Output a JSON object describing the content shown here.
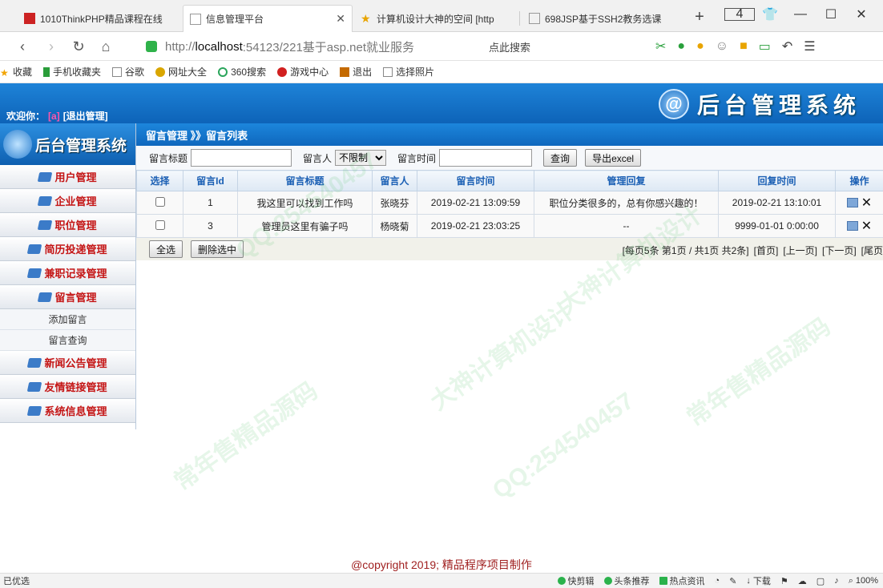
{
  "browser": {
    "tabs": [
      {
        "title": "1010ThinkPHP精品课程在线",
        "favicon_color": "#cc2222"
      },
      {
        "title": "信息管理平台",
        "favicon_color": "#999999",
        "active": true
      },
      {
        "title": "计算机设计大神的空间 [http",
        "favicon_color": "#e8a400"
      },
      {
        "title": "698JSP基于SSH2教务选课",
        "favicon_color": "#999999"
      }
    ],
    "tab_count": "4",
    "address": {
      "prefix": "http://",
      "host": "localhost",
      "rest": ":54123/221基于asp.net就业服务"
    },
    "search_placeholder": "点此搜索",
    "bookmarks": [
      {
        "label": "收藏",
        "icon": "star-icon",
        "color": "#f2a400"
      },
      {
        "label": "手机收藏夹",
        "icon": "phone-icon",
        "color": "#2a9d3a"
      },
      {
        "label": "谷歌",
        "icon": "page-icon",
        "color": "#888888"
      },
      {
        "label": "网址大全",
        "icon": "globe-icon",
        "color": "#d9a600"
      },
      {
        "label": "360搜索",
        "icon": "search-icon",
        "color": "#2aa55b"
      },
      {
        "label": "游戏中心",
        "icon": "game-icon",
        "color": "#d12020"
      },
      {
        "label": "退出",
        "icon": "exit-icon",
        "color": "#c46a00"
      },
      {
        "label": "选择照片",
        "icon": "page-icon",
        "color": "#888888"
      }
    ]
  },
  "header": {
    "welcome_prefix": "欢迎你：",
    "username": "[a]",
    "logout": "[退出管理]",
    "logo_glyph": "@",
    "title": "后台管理系统"
  },
  "sidebar": {
    "logo_text": "后台管理系统",
    "menu": [
      {
        "label": "用户管理"
      },
      {
        "label": "企业管理"
      },
      {
        "label": "职位管理"
      },
      {
        "label": "简历投递管理"
      },
      {
        "label": "兼职记录管理"
      },
      {
        "label": "留言管理",
        "submenu": [
          "添加留言",
          "留言查询"
        ]
      },
      {
        "label": "新闻公告管理"
      },
      {
        "label": "友情链接管理"
      },
      {
        "label": "系统信息管理"
      }
    ]
  },
  "main": {
    "breadcrumb": "留言管理 》》留言列表",
    "filters": {
      "title_label": "留言标题",
      "person_label": "留言人",
      "person_select": "不限制",
      "time_label": "留言时间",
      "query_button": "查询",
      "export_button": "导出excel"
    },
    "table": {
      "columns": [
        "选择",
        "留言Id",
        "留言标题",
        "留言人",
        "留言时间",
        "管理回复",
        "回复时间",
        "操作"
      ],
      "rows": [
        {
          "id": "1",
          "title": "我这里可以找到工作吗",
          "person": "张晓芬",
          "time": "2019-02-21 13:09:59",
          "reply": "职位分类很多的，总有你感兴趣的！",
          "reply_time": "2019-02-21 13:10:01"
        },
        {
          "id": "3",
          "title": "管理员这里有骗子吗",
          "person": "杨晓菊",
          "time": "2019-02-21 23:03:25",
          "reply": "--",
          "reply_time": "9999-01-01 0:00:00"
        }
      ]
    },
    "footer": {
      "select_all": "全选",
      "delete_selected": "删除选中",
      "pager_info": "[每页5条 第1页 / 共1页 共2条]",
      "first": "[首页]",
      "prev": "[上一页]",
      "next": "[下一页]",
      "last": "[尾页"
    }
  },
  "copyright": "@copyright 2019; 精品程序项目制作",
  "statusbar": {
    "left": "已优选",
    "items": [
      {
        "label": "快剪辑",
        "color": "#2bb24c"
      },
      {
        "label": "头条推荐",
        "color": "#2bb24c"
      },
      {
        "label": "热点资讯",
        "color": "#2bb24c"
      },
      {
        "label": "下载",
        "color": "#666666"
      }
    ],
    "zoom": "100%"
  },
  "watermarks": [
    "QQ:254540457",
    "大神计算机设计",
    "常年售精品源码"
  ]
}
